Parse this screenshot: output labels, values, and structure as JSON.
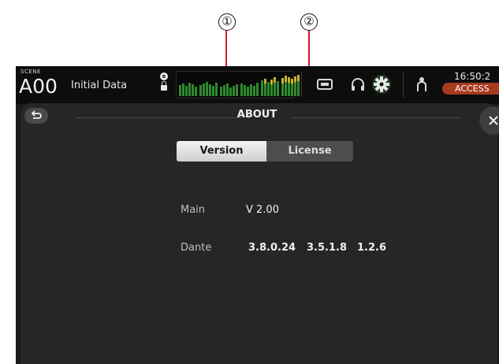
{
  "callouts": [
    "①",
    "②"
  ],
  "colors": {
    "accent": "#d11a2a",
    "access_badge": "#a83a1f",
    "screen_bg": "#1b1b1b",
    "panel_bg": "#262626"
  },
  "header": {
    "scene_tag": "SCENE",
    "scene_number": "A00",
    "scene_name": "Initial Data",
    "time": "16:50:2",
    "access_label": "ACCESS"
  },
  "icons": {
    "lock": "lock-icon",
    "recorder": "recorder-icon",
    "headphones": "headphones-icon",
    "setup": "gear-icon",
    "user": "user-icon",
    "back": "back-icon",
    "close": "close-icon"
  },
  "about": {
    "title": "ABOUT",
    "tabs": [
      {
        "label": "Version",
        "selected": true
      },
      {
        "label": "License",
        "selected": false
      }
    ]
  },
  "version_info": {
    "main_label": "Main",
    "main_value": "V 2.00",
    "dante_label": "Dante",
    "dante_values": [
      "3.8.0.24",
      "3.5.1.8",
      "1.2.6"
    ]
  }
}
